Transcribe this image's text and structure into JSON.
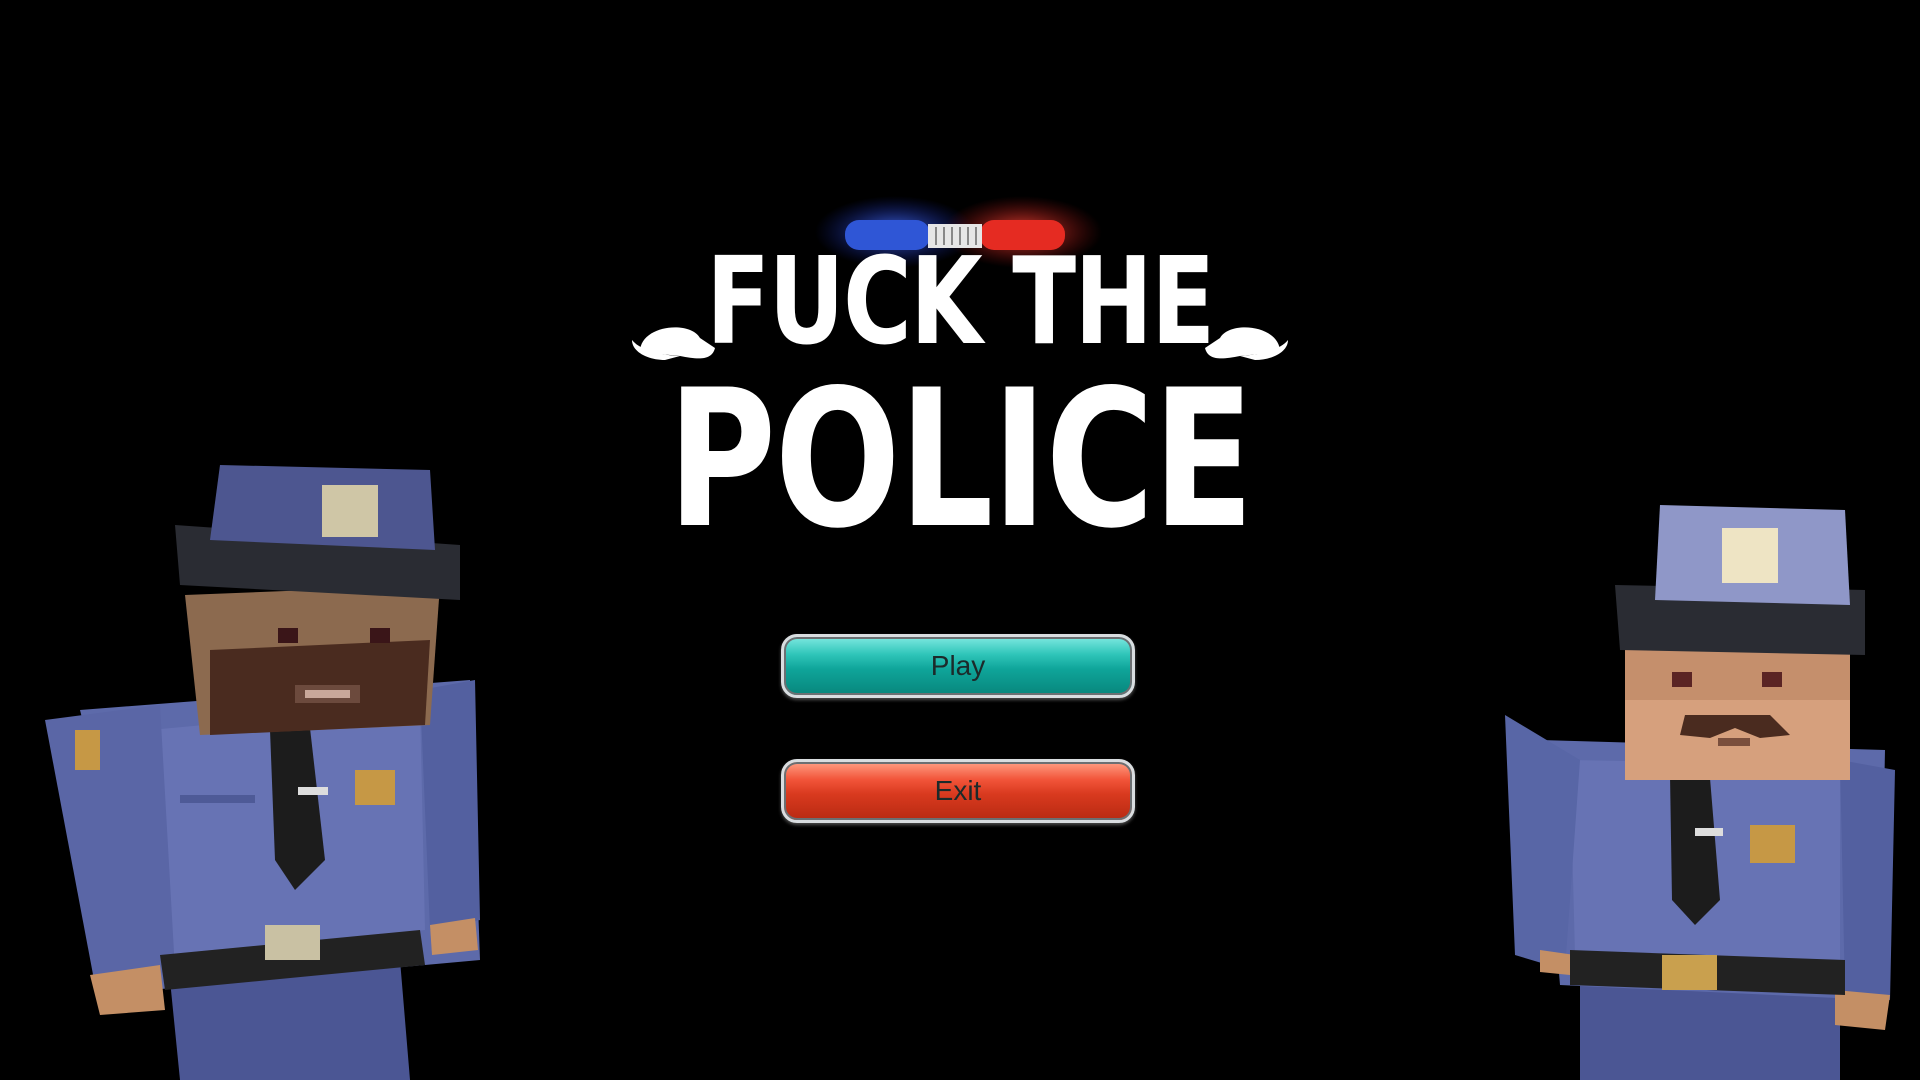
{
  "title": {
    "line1": "FUCK THE",
    "line2": "POLICE"
  },
  "menu": {
    "play_label": "Play",
    "exit_label": "Exit"
  },
  "colors": {
    "background": "#000000",
    "title": "#ffffff",
    "play_button": "#14a89d",
    "exit_button": "#dd3d22",
    "siren_blue": "#2f56d6",
    "siren_red": "#e52b22",
    "uniform": "#5a67a8"
  },
  "icons": {
    "siren": "police-siren-icon",
    "hat": "police-hat-icon"
  }
}
